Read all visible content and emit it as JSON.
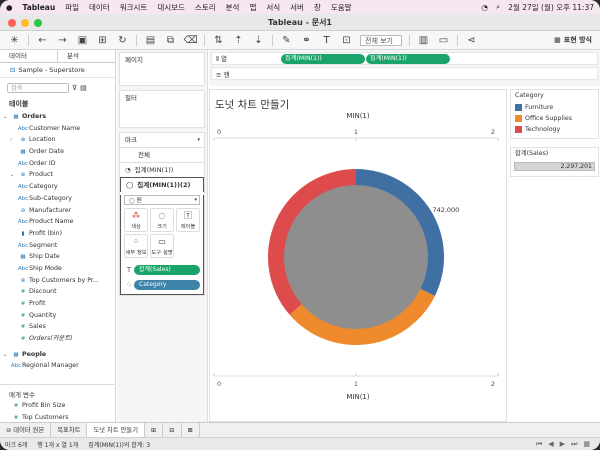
{
  "macbar": {
    "app": "Tableau",
    "menus": [
      "파일",
      "데이터",
      "워크시트",
      "대시보드",
      "스토리",
      "분석",
      "맵",
      "서식",
      "서버",
      "창",
      "도움말"
    ],
    "clock": "2월 27일 (월) 오후 11:37"
  },
  "window": {
    "title": "Tableau - 문서1"
  },
  "toolbar": {
    "fit": "전체 보기",
    "show_me": "표현 방식"
  },
  "left": {
    "tabs": [
      "데이터",
      "분석"
    ],
    "datasource": "Sample - Superstore",
    "search_placeholder": "검색",
    "tables_label": "테이블",
    "orders": "Orders",
    "orders_fields": [
      {
        "icon": "Abc",
        "label": "Customer Name",
        "ar": ""
      },
      {
        "icon": "⊕",
        "label": "Location",
        "ar": "›"
      },
      {
        "icon": "▦",
        "label": "Order Date",
        "ar": ""
      },
      {
        "icon": "Abc",
        "label": "Order ID",
        "ar": ""
      },
      {
        "icon": "⊕",
        "label": "Product",
        "ar": "⌄"
      },
      {
        "icon": "Abc",
        "label": "Category",
        "ar": "",
        "indent": true
      },
      {
        "icon": "Abc",
        "label": "Sub-Category",
        "ar": "",
        "indent": true
      },
      {
        "icon": "⊘",
        "label": "Manufacturer",
        "ar": "",
        "indent": true
      },
      {
        "icon": "Abc",
        "label": "Product Name",
        "ar": "",
        "indent": true
      },
      {
        "icon": "▮",
        "label": "Profit (bin)",
        "ar": ""
      },
      {
        "icon": "Abc",
        "label": "Segment",
        "ar": ""
      },
      {
        "icon": "▦",
        "label": "Ship Date",
        "ar": ""
      },
      {
        "icon": "Abc",
        "label": "Ship Mode",
        "ar": ""
      },
      {
        "icon": "⊗",
        "label": "Top Customers by Pr...",
        "ar": ""
      },
      {
        "icon": "#",
        "label": "Discount",
        "ar": "",
        "green": true
      },
      {
        "icon": "#",
        "label": "Profit",
        "ar": "",
        "green": true
      },
      {
        "icon": "#",
        "label": "Quantity",
        "ar": "",
        "green": true
      },
      {
        "icon": "#",
        "label": "Sales",
        "ar": "",
        "green": true
      },
      {
        "icon": "#",
        "label": "Orders(카운트)",
        "ar": "",
        "green": true,
        "italic": true
      }
    ],
    "people": "People",
    "people_fields": [
      {
        "icon": "Abc",
        "label": "Regional Manager"
      }
    ],
    "params_label": "매개 변수",
    "params": [
      "Profit Bin Size",
      "Top Customers"
    ]
  },
  "pages_label": "페이지",
  "filters_label": "필터",
  "marks": {
    "header": "마크",
    "all": "전체",
    "row1": "집계(MIN(1))",
    "row2": "집계(MIN(1))(2)",
    "type": "원",
    "buttons": [
      {
        "icon": "color-icon",
        "label": "색상"
      },
      {
        "icon": "size-icon",
        "label": "크기"
      },
      {
        "icon": "label-icon",
        "label": "레이블"
      },
      {
        "icon": "detail-icon",
        "label": "세부 정보"
      },
      {
        "icon": "tooltip-icon",
        "label": "도구 설명"
      }
    ],
    "pill_sales": "합계(Sales)",
    "pill_category": "Category"
  },
  "shelves": {
    "columns_label": "열",
    "rows_label": "행",
    "col_pills": [
      "집계(MIN(1))",
      "집계(MIN(1))"
    ]
  },
  "view": {
    "title": "도넛 차트 만들기"
  },
  "chart_data": {
    "type": "pie",
    "subtype": "donut",
    "title": "도넛 차트 만들기",
    "xlabel": "MIN(1)",
    "ticks_top": [
      "0",
      "1",
      "2"
    ],
    "ticks_bottom": [
      "0",
      "1",
      "2"
    ],
    "xlim": [
      0,
      2
    ],
    "total": 2297201,
    "total_label": "2,297,201",
    "series": [
      {
        "name": "Furniture",
        "value": 742000,
        "label": "742,000",
        "color": "#3f6fa3"
      },
      {
        "name": "Office Supplies",
        "value": 719047,
        "label": "",
        "color": "#ee8a2c"
      },
      {
        "name": "Technology",
        "value": 836154,
        "label": "",
        "color": "#dd4b4c"
      }
    ],
    "hole_color": "#8e8e8e",
    "legend_position": "right"
  },
  "legend": {
    "title": "Category",
    "items": [
      {
        "label": "Furniture",
        "color": "#3f6fa3"
      },
      {
        "label": "Office Supplies",
        "color": "#ee8a2c"
      },
      {
        "label": "Technology",
        "color": "#dd4b4c"
      }
    ],
    "sum_title": "합계(Sales)",
    "sum_value": "2,297,201"
  },
  "bottom": {
    "tabs": [
      "데이터 원본",
      "목표차트",
      "도넛 차트 만들기"
    ]
  },
  "status": {
    "marks": "마크 6개",
    "rows": "행 1개 x 열 1개",
    "sum": "집계(MIN(1))의 합계: 3"
  }
}
